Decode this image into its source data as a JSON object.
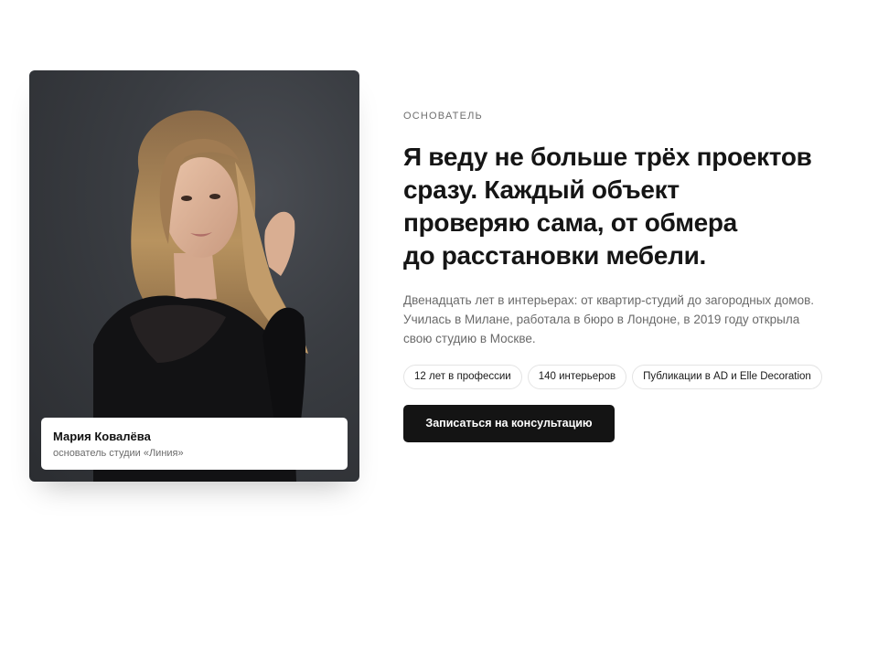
{
  "portrait": {
    "icon": "founder-portrait-photo",
    "background_color": "#35373c"
  },
  "caption": {
    "name": "Мария Ковалёва",
    "role": "основатель студии «Линия»"
  },
  "about": {
    "eyebrow": "ОСНОВАТЕЛЬ",
    "headline_lines": [
      "Я веду не больше трёх проектов",
      "сразу. Каждый объект",
      "проверяю сама, от обмера",
      "до расстановки мебели."
    ],
    "lead_lines": [
      "Двенадцать лет в интерьерах: от квартир-студий до загородных домов.",
      "Училась в Милане, работала в бюро в Лондоне, в 2019 году открыла",
      "свою студию в Москве."
    ],
    "chips": [
      "12 лет в профессии",
      "140 интерьеров",
      "Публикации в AD и Elle Decoration"
    ],
    "cta_label": "Записаться на консультацию"
  },
  "colors": {
    "text": "#141414",
    "muted": "#6a6a6a",
    "button": "#141414",
    "chip_border": "#e4e4e4"
  }
}
